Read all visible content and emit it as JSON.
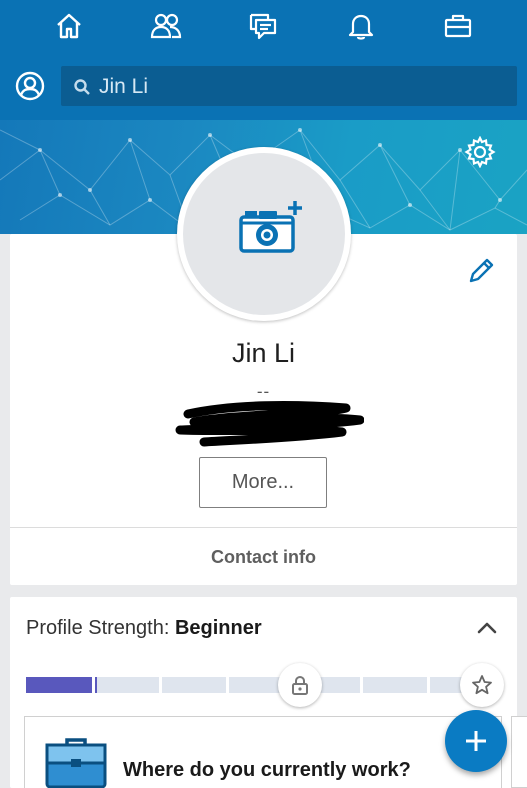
{
  "nav": {
    "items": [
      {
        "icon": "home-icon"
      },
      {
        "icon": "my-network-icon"
      },
      {
        "icon": "messaging-icon"
      },
      {
        "icon": "notifications-icon"
      },
      {
        "icon": "jobs-icon"
      }
    ]
  },
  "search": {
    "value": "Jin Li"
  },
  "profile": {
    "name": "Jin Li",
    "headline": "--",
    "more_label": "More...",
    "contact_label": "Contact info"
  },
  "strength": {
    "label": "Profile Strength: ",
    "level": "Beginner",
    "progress_fraction": 0.15,
    "segments": 7
  },
  "prompt": {
    "question": "Where do you currently work?"
  },
  "colors": {
    "brand_blue": "#0a72b4",
    "search_bg": "#0b5d92",
    "meter_fill": "#5958bd",
    "meter_empty": "#dfe5ee",
    "accent_blue": "#0a7bc3"
  }
}
